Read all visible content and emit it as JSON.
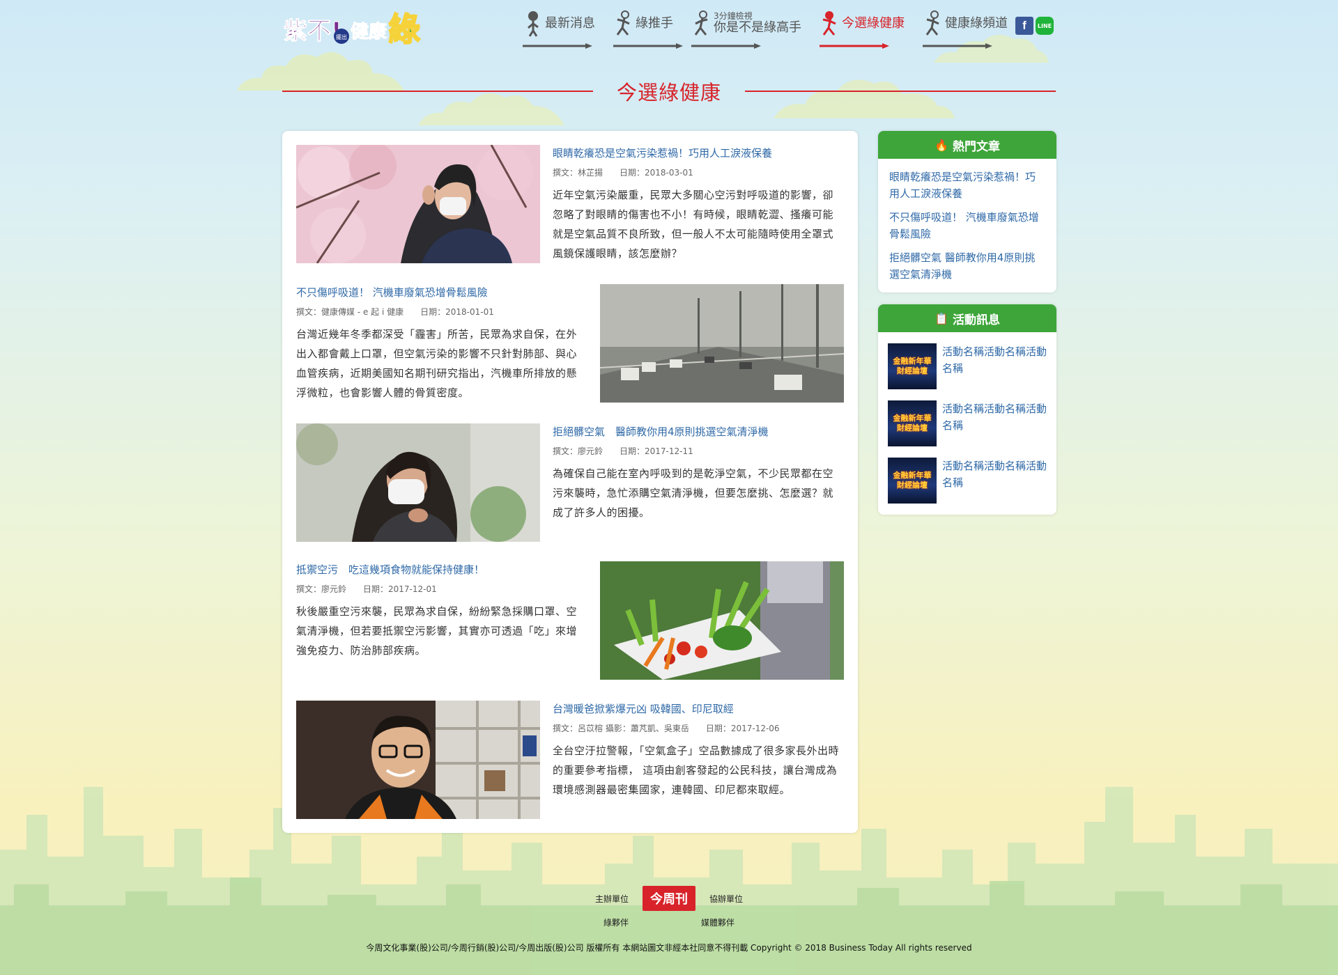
{
  "brand": {
    "logo_label": "紫不!擺出健康綠",
    "colors": {
      "accent": "#d8232a",
      "green": "#3ea53a",
      "link": "#2f69a7"
    }
  },
  "nav": {
    "items": [
      {
        "label": "最新消息",
        "sub": "",
        "active": false
      },
      {
        "label": "綠推手",
        "sub": "",
        "active": false
      },
      {
        "label": "你是不是綠高手",
        "sub": "3分鐘檢視",
        "active": false
      },
      {
        "label": "今選綠健康",
        "sub": "",
        "active": true
      },
      {
        "label": "健康綠頻道",
        "sub": "",
        "active": false
      }
    ],
    "social": {
      "facebook": "f",
      "line": "LINE"
    }
  },
  "section_title": "今選綠健康",
  "articles": [
    {
      "title": "眼睛乾癢恐是空氣污染惹禍！巧用人工淚液保養",
      "author": "撰文：林芷揚",
      "date": "日期：2018-03-01",
      "summary": "近年空氣污染嚴重，民眾大多關心空污對呼吸道的影響，卻忽略了對眼睛的傷害也不小！有時候，眼睛乾澀、搔癢可能就是空氣品質不良所致，但一般人不太可能隨時使用全罩式風鏡保護眼睛，該怎麼辦？",
      "image": "woman-mask-rubbing-eye-photo"
    },
    {
      "title": "不只傷呼吸道！ 汽機車廢氣恐增骨鬆風險",
      "author": "撰文：健康傳媒 - e 起 i 健康",
      "date": "日期：2018-01-01",
      "summary": "台灣近幾年冬季都深受「霾害」所苦，民眾為求自保，在外出入都會戴上口罩，但空氣污染的影響不只針對肺部、與心血管疾病，近期美國知名期刊研究指出，汽機車所排放的懸浮微粒，也會影響人體的骨質密度。",
      "image": "smoggy-highway-traffic-photo"
    },
    {
      "title": "拒絕髒空氣　醫師教你用4原則挑選空氣清淨機",
      "author": "撰文：廖元鈴",
      "date": "日期：2017-12-11",
      "summary": "為確保自己能在室內呼吸到的是乾淨空氣，不少民眾都在空污來襲時，急忙添購空氣清淨機，但要怎麼挑、怎麼選？就成了許多人的困擾。",
      "image": "woman-mask-coughing-photo"
    },
    {
      "title": "抵禦空污　吃這幾項食物就能保持健康！",
      "author": "撰文：廖元鈴",
      "date": "日期：2017-12-01",
      "summary": "秋後嚴重空污來襲，民眾為求自保，紛紛緊急採購口罩、空氣清淨機，但若要抵禦空污影響，其實亦可透過「吃」來增強免疫力、防治肺部疾病。",
      "image": "vegetable-crate-photo"
    },
    {
      "title": "台灣暖爸掀紫爆元凶 吸韓國、印尼取經",
      "author": "撰文：呂苡榕 攝影：蕭芃凱、吳東岳",
      "date": "日期：2017-12-06",
      "summary": "全台空汙拉警報，「空氣盒子」空品數據成了很多家長外出時的重要參考指標， 這項由創客發起的公民科技，讓台灣成為環境感測器最密集國家，連韓國、印尼都來取經。",
      "image": "man-glasses-portrait-photo"
    }
  ],
  "sidebar": {
    "hot": {
      "heading": "熱門文章",
      "icon": "fire-icon",
      "items": [
        "眼睛乾癢恐是空氣污染惹禍！巧用人工淚液保養",
        "不只傷呼吸道！ 汽機車廢氣恐增骨鬆風險",
        "拒絕髒空氣 醫師教你用4原則挑選空氣清淨機"
      ]
    },
    "events": {
      "heading": "活動訊息",
      "icon": "clipboard-icon",
      "items": [
        {
          "title": "活動名稱活動名稱活動名稱",
          "thumb_l1": "金融新年華",
          "thumb_l2": "財經論壇"
        },
        {
          "title": "活動名稱活動名稱活動名稱",
          "thumb_l1": "金融新年華",
          "thumb_l2": "財經論壇"
        },
        {
          "title": "活動名稱活動名稱活動名稱",
          "thumb_l1": "金融新年華",
          "thumb_l2": "財經論壇"
        }
      ]
    }
  },
  "footer": {
    "host_label": "主辦單位",
    "co_label": "協辦單位",
    "host_logo": "今周刊",
    "green_partner": "綠夥伴",
    "media_partner": "媒體夥伴",
    "copyright": "今周文化事業(股)公司/今周行銷(股)公司/今周出版(股)公司 版權所有 本網站圖文非經本社同意不得刊載 Copyright © 2018 Business Today All rights reserved"
  }
}
